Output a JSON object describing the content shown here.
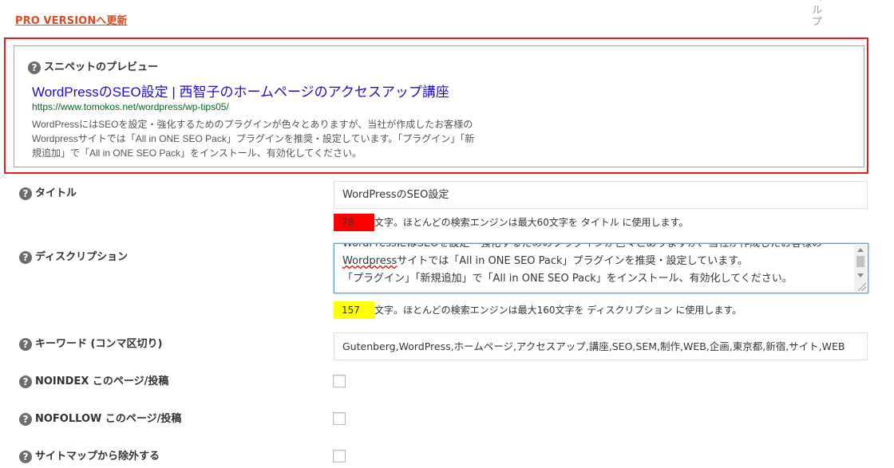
{
  "header": {
    "pro_link": "PRO VERSIONへ更新",
    "help_tab": "ヘルプ"
  },
  "snippet": {
    "heading": "スニペットのプレビュー",
    "title": "WordPressのSEO設定 | 西智子のホームページのアクセスアップ講座",
    "url": "https://www.tomokos.net/wordpress/wp-tips05/",
    "description_lines": [
      "WordPressにはSEOを設定・強化するためのプラグインが色々とありますが、当社が作成したお客様の",
      "Wordpressサイトでは「All in ONE SEO Pack」プラグインを推奨・設定しています。「プラグイン」「新",
      "規追加」で「All in ONE SEO Pack」をインストール、有効化してください。"
    ]
  },
  "fields": {
    "title": {
      "label": "タイトル",
      "value": "WordPressのSEO設定",
      "count": "78",
      "count_color": "#ff0000",
      "counter_text": "文字。ほとんどの検索エンジンは最大60文字を タイトル に使用します。"
    },
    "description": {
      "label": "ディスクリプション",
      "lines": [
        "WordPressにはSEOを設定・強化するためのプラグインが色々とありますが、当社が作成したお客様の",
        "Wordpressサイトでは「All in ONE SEO Pack」プラグインを推奨・設定しています。",
        "「プラグイン」「新規追加」で「All in ONE SEO Pack」をインストール、有効化してください。"
      ],
      "count": "157",
      "count_color": "#ffff00",
      "counter_text": "文字。ほとんどの検索エンジンは最大160文字を ディスクリプション に使用します。"
    },
    "keywords": {
      "label": "キーワード (コンマ区切り)",
      "value": "Gutenberg,WordPress,ホームページ,アクセスアップ,講座,SEO,SEM,制作,WEB,企画,東京都,新宿,サイト,WEB"
    },
    "noindex": {
      "label": "NOINDEX このページ/投稿",
      "checked": false
    },
    "nofollow": {
      "label": "NOFOLLOW このページ/投稿",
      "checked": false
    },
    "sitemap_exclude": {
      "label": "サイトマップから除外する",
      "checked": false
    }
  },
  "icons": {
    "help": "?"
  }
}
